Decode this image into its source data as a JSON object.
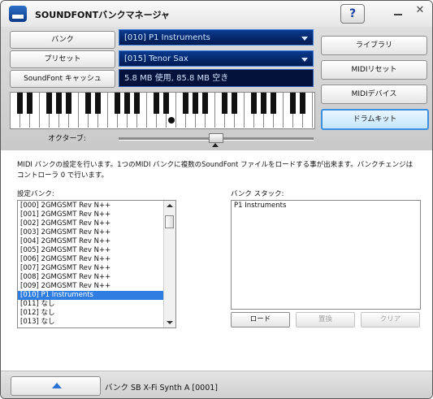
{
  "window": {
    "title": "SOUNDFONTバンクマネージャ",
    "help_label": "?",
    "close_label": "✕"
  },
  "left_buttons": {
    "bank": "バンク",
    "preset": "プリセット",
    "soundfont_cache": "SoundFont キャッシュ"
  },
  "combos": {
    "bank_value": "[010] P1 Instruments",
    "preset_value": "[015] Tenor Sax"
  },
  "memory_status": "5.8 MB 使用, 85.8 MB 空き",
  "right_buttons": {
    "library": "ライブラリ",
    "midi_reset": "MIDIリセット",
    "midi_device": "MIDIデバイス",
    "drum_kit": "ドラムキット"
  },
  "octave_label": "オクターブ:",
  "description": "MIDI バンクの設定を行います。1つのMIDI バンクに複数のSoundFont ファイルをロードする事が出来ます。バンクチェンジはコントローラ 0 で行います。",
  "bank_list": {
    "label": "設定バンク:",
    "items": [
      "[000] 2GMGSMT Rev N++",
      "[001] 2GMGSMT Rev N++",
      "[002] 2GMGSMT Rev N++",
      "[003] 2GMGSMT Rev N++",
      "[004] 2GMGSMT Rev N++",
      "[005] 2GMGSMT Rev N++",
      "[006] 2GMGSMT Rev N++",
      "[007] 2GMGSMT Rev N++",
      "[008] 2GMGSMT Rev N++",
      "[009] 2GMGSMT Rev N++",
      "[010] P1 Instruments",
      "[011] なし",
      "[012] なし",
      "[013] なし"
    ],
    "selected_index": 10
  },
  "bank_stack": {
    "label": "バンク スタック:",
    "items": [
      "P1 Instruments"
    ]
  },
  "stack_buttons": {
    "load": "ロード",
    "replace": "置換",
    "clear": "クリア"
  },
  "device": "バンク SB X-Fi Synth A [0001]"
}
